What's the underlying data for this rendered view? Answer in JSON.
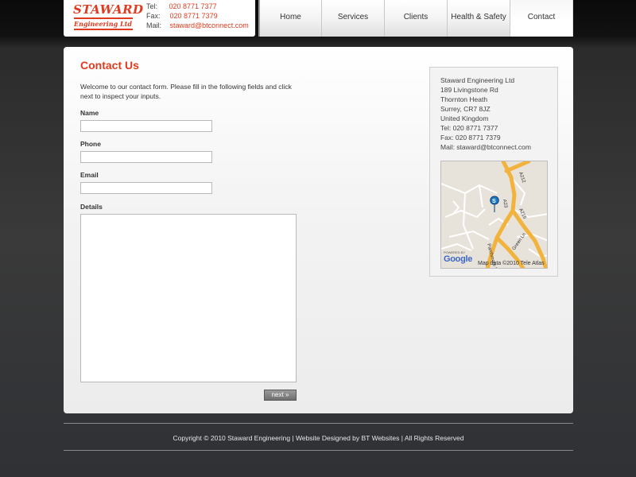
{
  "header": {
    "logo": {
      "title": "STAWARD",
      "subtitle": "Engineering Ltd",
      "brand_color": "#e03b1f"
    },
    "contact": {
      "tel_label": "Tel:",
      "tel_value": "020 8771 7377",
      "fax_label": "Fax:",
      "fax_value": "020 8771 7379",
      "mail_label": "Mail:",
      "mail_value": "staward@btconnect.com"
    },
    "nav": [
      {
        "label": "Home"
      },
      {
        "label": "Services"
      },
      {
        "label": "Clients"
      },
      {
        "label": "Health & Safety"
      },
      {
        "label": "Contact",
        "active": true
      }
    ]
  },
  "main": {
    "title": "Contact Us",
    "intro": "Welcome to our contact form. Please fill in the following fields and click next to inspect your inputs.",
    "form": {
      "name_label": "Name",
      "name_value": "",
      "phone_label": "Phone",
      "phone_value": "",
      "email_label": "Email",
      "email_value": "",
      "details_label": "Details",
      "details_value": "",
      "next_label": "next »"
    },
    "sidebar": {
      "address_lines": [
        "Staward Engineering Ltd",
        "189 Livingstone Rd",
        "Thornton Heath",
        "Surrey, CR7 8JZ",
        "United Kingdom",
        "Tel: 020 8771 7377",
        "Fax: 020 8771 7379",
        "Mail: staward@btconnect.com"
      ],
      "map": {
        "road_labels": [
          "A212",
          "A215",
          "A23"
        ],
        "street_labels": [
          "Parchmore Rd",
          "Green Ln"
        ],
        "marker_letter": "S",
        "powered_by": "POWERED BY",
        "provider": "Google",
        "attribution": "Map data ©2010 Tele Atlas"
      }
    }
  },
  "footer": {
    "text": "Copyright © 2010 Staward Engineering | Website Designed by BT Websites | All Rights Reserved"
  }
}
